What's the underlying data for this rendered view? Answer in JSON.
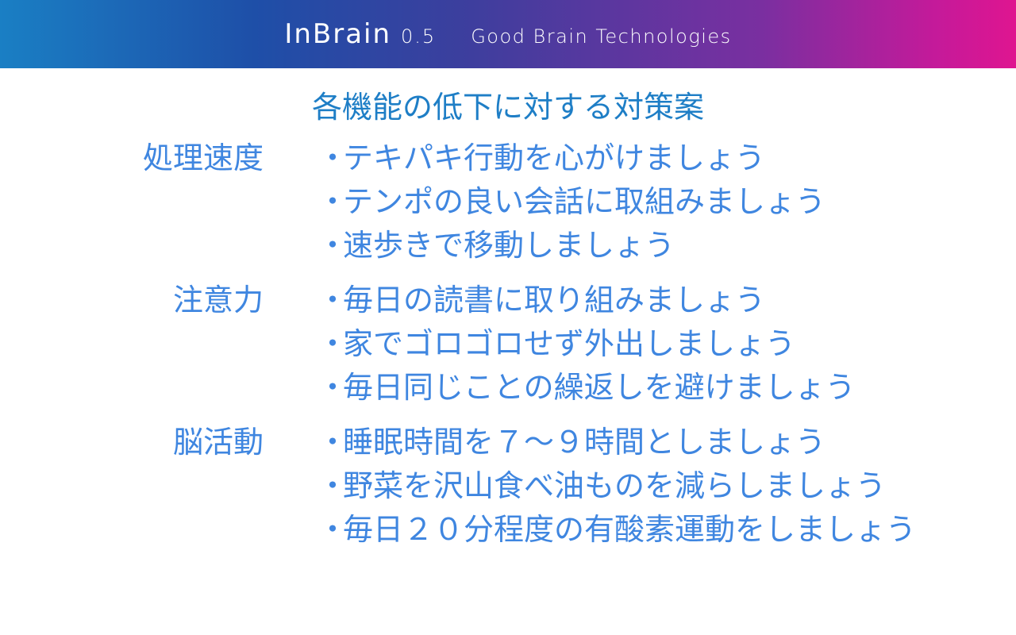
{
  "header": {
    "app_name": "InBrain",
    "version": "0.5",
    "company": "Good Brain Technologies"
  },
  "title": "各機能の低下に対する対策案",
  "sections": [
    {
      "category": "処理速度",
      "items": [
        "テキパキ行動を心がけましょう",
        "テンポの良い会話に取組みましょう",
        "速歩きで移動しましょう"
      ]
    },
    {
      "category": "注意力",
      "items": [
        "毎日の読書に取り組みましょう",
        "家でゴロゴロせず外出しましょう",
        "毎日同じことの繰返しを避けましょう"
      ]
    },
    {
      "category": "脳活動",
      "items": [
        "睡眠時間を７～９時間としましょう",
        "野菜を沢山食べ油ものを減らしましょう",
        "毎日２０分程度の有酸素運動をしましょう"
      ]
    }
  ],
  "bullet": "・",
  "colors": {
    "title": "#1e7ec6",
    "text": "#3f86e0",
    "header_start": "#1a7fc4",
    "header_end": "#df1590"
  }
}
